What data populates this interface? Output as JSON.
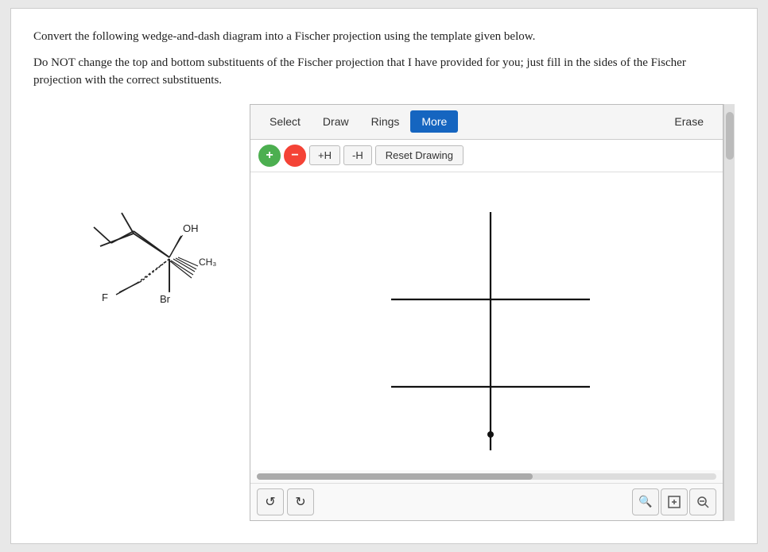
{
  "instructions": {
    "line1": "Convert the following wedge-and-dash diagram into a Fischer projection using the template given below.",
    "line2": "Do NOT change the top and bottom substituents of the Fischer projection that I have provided for you; just fill in the sides of the Fischer projection with the correct substituents."
  },
  "toolbar": {
    "select_label": "Select",
    "draw_label": "Draw",
    "rings_label": "Rings",
    "more_label": "More",
    "erase_label": "Erase"
  },
  "subtoolbar": {
    "plus_label": "+",
    "minus_label": "−",
    "add_h_label": "+H",
    "remove_h_label": "-H",
    "reset_label": "Reset Drawing"
  },
  "bottom_controls": {
    "undo_icon": "↺",
    "redo_icon": "↻",
    "zoom_in_icon": "🔍",
    "zoom_fit_icon": "⊡",
    "zoom_out_icon": "🔍"
  },
  "molecule": {
    "labels": [
      "OH",
      "CH₃",
      "F",
      "Br"
    ]
  }
}
